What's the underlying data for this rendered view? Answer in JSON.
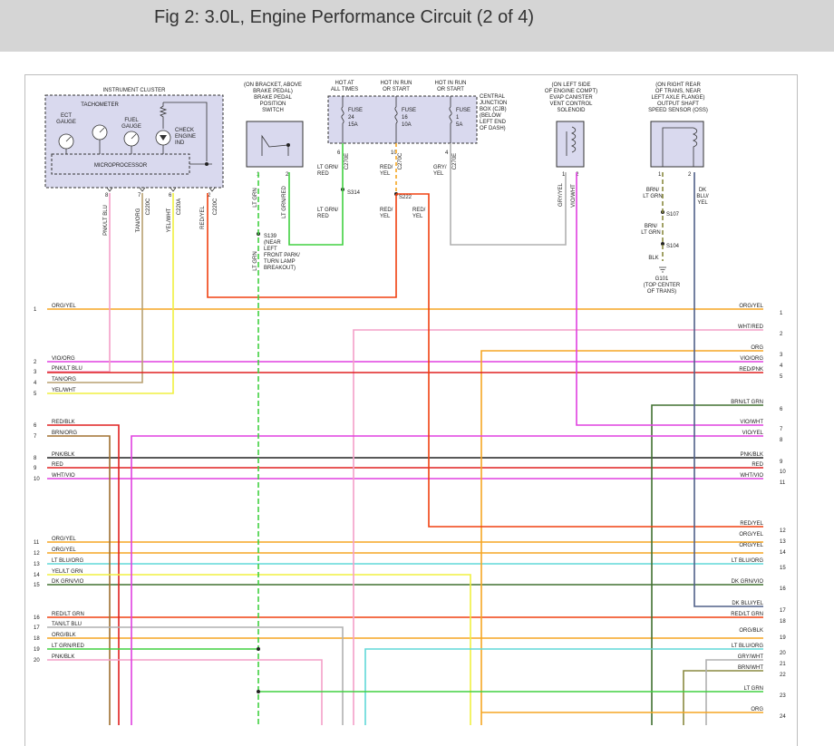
{
  "title": "Fig 2: 3.0L, Engine Performance Circuit (2 of 4)",
  "components": {
    "instrument_cluster": "INSTRUMENT CLUSTER",
    "tachometer": "TACHOMETER",
    "ect_gauge": [
      "ECT",
      "GAUGE"
    ],
    "fuel_gauge": [
      "FUEL",
      "GAUGE"
    ],
    "check_engine": [
      "CHECK",
      "ENGINE",
      "IND"
    ],
    "microprocessor": "MICROPROCESSOR",
    "brake_switch_note": [
      "(ON BRACKET, ABOVE",
      "BRAKE PEDAL)",
      "BRAKE PEDAL",
      "POSITION",
      "SWITCH"
    ],
    "cjb_hots": [
      [
        "HOT AT",
        "ALL TIMES"
      ],
      [
        "HOT IN RUN",
        "OR START"
      ],
      [
        "HOT IN RUN",
        "OR START"
      ]
    ],
    "cjb_label": [
      "CENTRAL",
      "JUNCTION",
      "BOX (CJB)",
      "(BELOW",
      "LEFT END",
      "OF DASH)"
    ],
    "fuses": [
      [
        "FUSE",
        "24",
        "15A"
      ],
      [
        "FUSE",
        "16",
        "10A"
      ],
      [
        "FUSE",
        "1",
        "5A"
      ]
    ],
    "evap_note": [
      "(ON LEFT SIDE",
      "OF ENGINE COMPT)",
      "EVAP CANISTER",
      "VENT CONTROL",
      "SOLENOID"
    ],
    "oss_note": [
      "(ON RIGHT REAR",
      "OF TRANS, NEAR",
      "LEFT AXLE FLANGE)",
      "OUTPUT SHAFT",
      "SPEED SENSOR (OSS)"
    ],
    "s139_note": [
      "S139",
      "(NEAR",
      "LEFT",
      "FRONT PARK/",
      "TURN LAMP",
      "BREAKOUT)"
    ],
    "g101_note": [
      "G101",
      "(TOP CENTER",
      "OF TRANS)"
    ]
  },
  "pins": {
    "cluster": [
      "8",
      "7",
      "6",
      "2"
    ],
    "cluster_conn": [
      "C220C",
      "C220A",
      "C220C"
    ],
    "switch": [
      "1",
      "2"
    ],
    "cjb": [
      "6",
      "10",
      "4"
    ],
    "cjb_conn": [
      "C270E",
      "C270C",
      "C270E"
    ],
    "evap": [
      "1",
      "2"
    ],
    "oss": [
      "1",
      "2"
    ]
  },
  "splices": [
    "S314",
    "S222",
    "S107",
    "S104"
  ],
  "wire_labels": {
    "pnk_ltblu": "PNK/LT BLU",
    "tan_org": "TAN/ORG",
    "yel_wht": "YEL/WHT",
    "red_yel": "RED/YEL",
    "lt_grn": "LT GRN",
    "lt_grn_red": "LT GRN/RED",
    "cjb_top": [
      [
        "LT GRN/",
        "RED"
      ],
      [
        "RED/",
        "YEL"
      ],
      [
        "GRY/",
        "YEL"
      ]
    ],
    "s314_down": [
      "LT GRN/",
      "RED"
    ],
    "s222_down": [
      [
        "RED/",
        "YEL"
      ],
      [
        "RED/",
        "YEL"
      ]
    ],
    "gry_yel": "GRY/YEL",
    "vio_wht": "VIO/WHT",
    "brn_ltgrn_top": [
      "BRN/",
      "LT GRN"
    ],
    "dk_blu_yel": [
      "DK",
      "BLU/",
      "YEL"
    ],
    "brn_ltgrn_mid": [
      "BRN/",
      "LT GRN"
    ],
    "blk": "BLK"
  },
  "left_rows": [
    {
      "num": "1",
      "label": "ORG/YEL"
    },
    {
      "num": "2",
      "label": "VIO/ORG"
    },
    {
      "num": "3",
      "label": "PNK/LT BLU"
    },
    {
      "num": "4",
      "label": "TAN/ORG"
    },
    {
      "num": "5",
      "label": "YEL/WHT"
    },
    {
      "num": "6",
      "label": "RED/BLK"
    },
    {
      "num": "7",
      "label": "BRN/ORG"
    },
    {
      "num": "8",
      "label": "PNK/BLK"
    },
    {
      "num": "9",
      "label": "RED"
    },
    {
      "num": "10",
      "label": "WHT/VIO"
    },
    {
      "num": "11",
      "label": "ORG/YEL"
    },
    {
      "num": "12",
      "label": "ORG/YEL"
    },
    {
      "num": "13",
      "label": "LT BLU/ORG"
    },
    {
      "num": "14",
      "label": "YEL/LT GRN"
    },
    {
      "num": "15",
      "label": "DK GRN/VIO"
    },
    {
      "num": "16",
      "label": "RED/LT GRN"
    },
    {
      "num": "17",
      "label": "TAN/LT BLU"
    },
    {
      "num": "18",
      "label": "ORG/BLK"
    },
    {
      "num": "19",
      "label": "LT GRN/RED"
    },
    {
      "num": "20",
      "label": "PNK/BLK"
    }
  ],
  "right_rows": [
    {
      "num": "1",
      "label": "ORG/YEL"
    },
    {
      "num": "2",
      "label": "WHT/RED"
    },
    {
      "num": "3",
      "label": "ORG"
    },
    {
      "num": "4",
      "label": "VIO/ORG"
    },
    {
      "num": "5",
      "label": "RED/PNK"
    },
    {
      "num": "6",
      "label": "BRN/LT GRN"
    },
    {
      "num": "7",
      "label": "VIO/WHT"
    },
    {
      "num": "8",
      "label": "VIO/YEL"
    },
    {
      "num": "9",
      "label": "PNK/BLK"
    },
    {
      "num": "10",
      "label": "RED"
    },
    {
      "num": "11",
      "label": "WHT/VIO"
    },
    {
      "num": "12",
      "label": "RED/YEL"
    },
    {
      "num": "13",
      "label": "ORG/YEL"
    },
    {
      "num": "14",
      "label": "ORG/YEL"
    },
    {
      "num": "15",
      "label": "LT BLU/ORG"
    },
    {
      "num": "16",
      "label": "DK GRN/VIO"
    },
    {
      "num": "17",
      "label": "DK BLU/YEL"
    },
    {
      "num": "18",
      "label": "RED/LT GRN"
    },
    {
      "num": "19",
      "label": "ORG/BLK"
    },
    {
      "num": "20",
      "label": "LT BLU/ORG"
    },
    {
      "num": "21",
      "label": "GRY/WHT"
    },
    {
      "num": "22",
      "label": "BRN/WHT"
    },
    {
      "num": "23",
      "label": "LT GRN"
    },
    {
      "num": "24",
      "label": "ORG"
    }
  ],
  "colors": {
    "orange": "#f5a623",
    "violet": "#e040e0",
    "pink": "#f4a0c8",
    "tan": "#b8a070",
    "yellow": "#f0f040",
    "red": "#e02020",
    "brown": "#a07030",
    "green": "#40d040",
    "redorange": "#f04010",
    "lightblue": "#60d8d8",
    "darkgreen": "#407030",
    "darkblue": "#506088",
    "olive": "#8a8a40",
    "gray": "#b0b0b0",
    "black": "#222222",
    "lavender": "#d9d9ee"
  }
}
